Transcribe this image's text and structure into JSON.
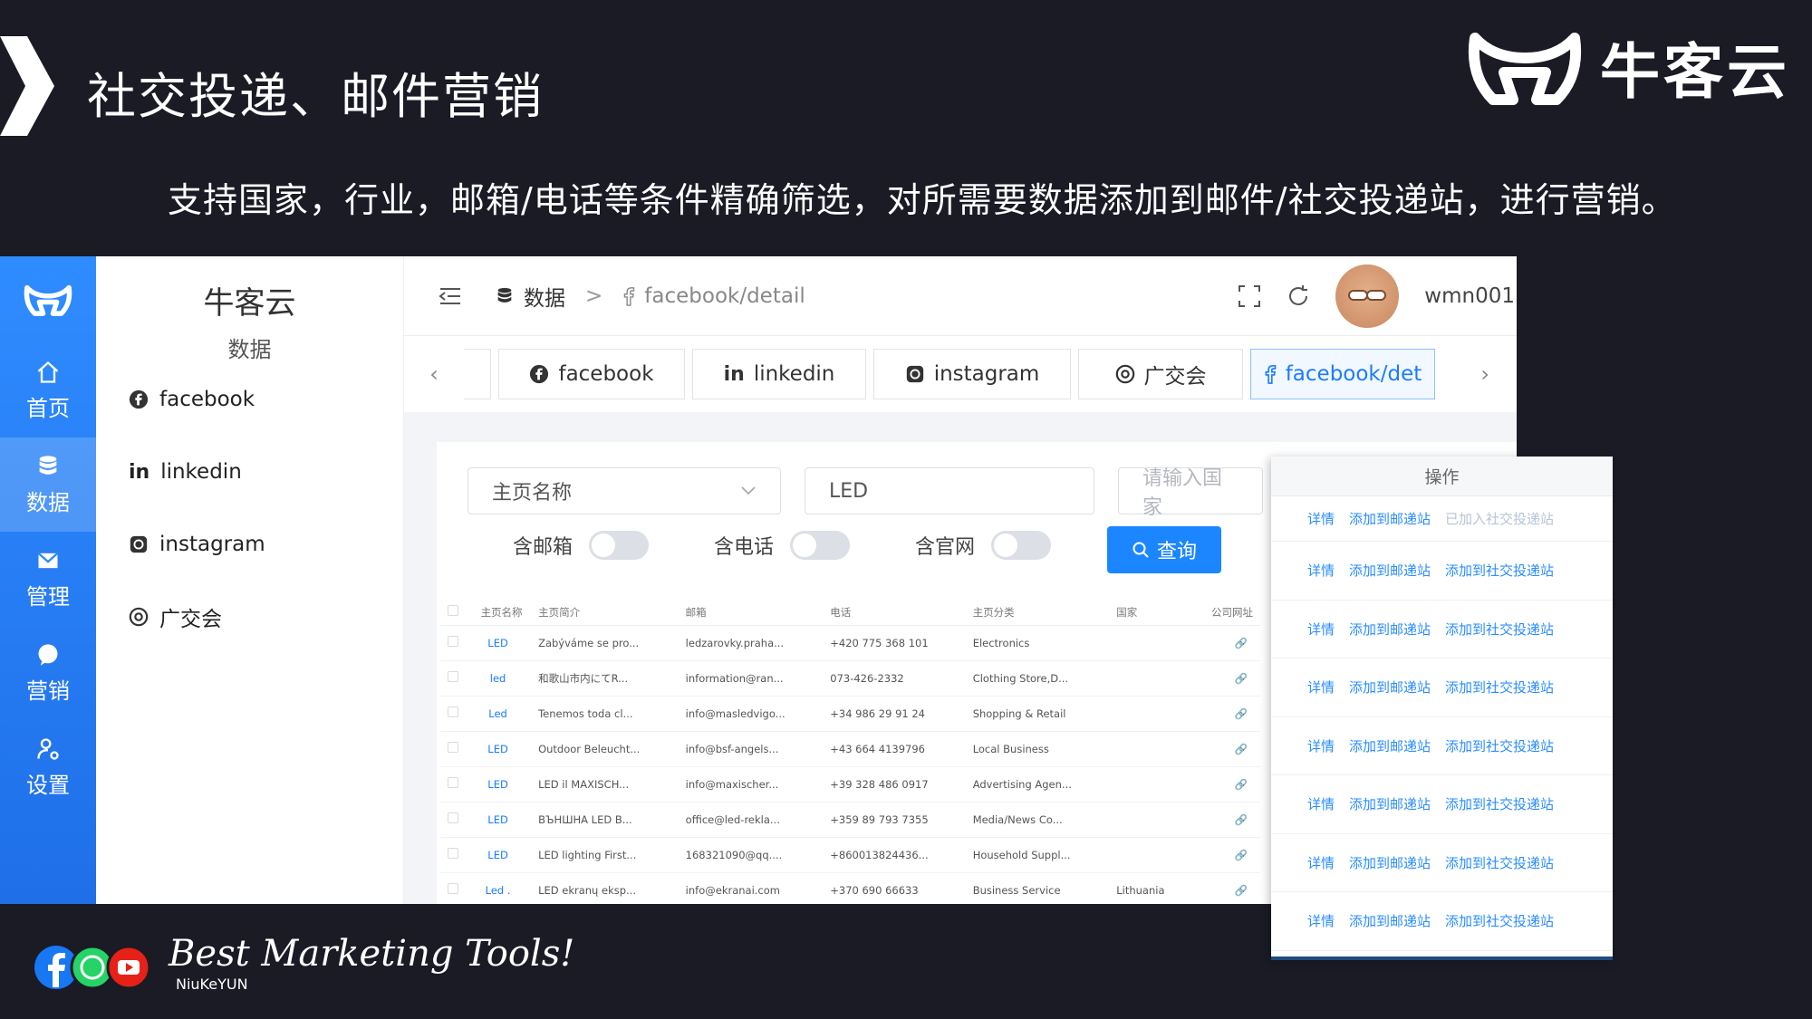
{
  "slide": {
    "title": "社交投递、邮件营销",
    "subtitle": "支持国家，行业，邮箱/电话等条件精确筛选，对所需要数据添加到邮件/社交投递站，进行营销。",
    "brand": "牛客云",
    "tagline": "Best Marketing Tools!",
    "tagline_sub": "NiuKeYUN"
  },
  "rail": [
    {
      "label": "首页",
      "icon": "home-icon"
    },
    {
      "label": "数据",
      "icon": "database-icon"
    },
    {
      "label": "管理",
      "icon": "mail-icon"
    },
    {
      "label": "营销",
      "icon": "chat-icon"
    },
    {
      "label": "设置",
      "icon": "user-settings-icon"
    }
  ],
  "side": {
    "title": "牛客云",
    "sub": "数据",
    "items": [
      "facebook",
      "linkedin",
      "instagram",
      "广交会"
    ]
  },
  "breadcrumb": {
    "first": "数据",
    "sep": ">",
    "second": "facebook/detail"
  },
  "user": {
    "name": "wmn001"
  },
  "tabs": [
    {
      "label": "facebook",
      "icon": "facebook-icon"
    },
    {
      "label": "linkedin",
      "icon": "linkedin-icon"
    },
    {
      "label": "instagram",
      "icon": "instagram-icon"
    },
    {
      "label": "广交会",
      "icon": "canton-fair-icon"
    },
    {
      "label": "facebook/det",
      "icon": "facebook-f-icon"
    }
  ],
  "filters": {
    "select_value": "主页名称",
    "keyword": "LED",
    "country_placeholder": "请输入国家",
    "toggles": [
      "含邮箱",
      "含电话",
      "含官网"
    ],
    "query_label": "查询"
  },
  "table": {
    "headers": [
      "",
      "主页名称",
      "主页简介",
      "邮箱",
      "电话",
      "主页分类",
      "国家",
      "公司网址"
    ],
    "rows": [
      [
        "LED",
        "Zabýváme se pro...",
        "ledzarovky.praha...",
        "+420 775 368 101",
        "Electronics",
        "",
        "🔗"
      ],
      [
        "led",
        "和歌山市内にてR...",
        "information@ran...",
        "073-426-2332",
        "Clothing Store,D...",
        "",
        "🔗"
      ],
      [
        "Led",
        "Tenemos toda cl...",
        "info@masledvigo...",
        "+34 986 29 91 24",
        "Shopping & Retail",
        "",
        "🔗"
      ],
      [
        "LED",
        "Outdoor Beleucht...",
        "info@bsf-angels...",
        "+43 664 4139796",
        "Local Business",
        "",
        "🔗"
      ],
      [
        "LED",
        "LED il MAXISCH...",
        "info@maxischer...",
        "+39 328 486 0917",
        "Advertising Agen...",
        "",
        "🔗"
      ],
      [
        "LED",
        "ВЪНШНА LED B...",
        "office@led-rekla...",
        "+359 89 793 7355",
        "Media/News Co...",
        "",
        "🔗"
      ],
      [
        "LED",
        "LED lighting First...",
        "168321090@qq....",
        "+860013824436...",
        "Household Suppl...",
        "",
        "🔗"
      ],
      [
        "Led .",
        "LED ekranų eksp...",
        "info@ekranai.com",
        "+370 690 66633",
        "Business Service",
        "Lithuania",
        "🔗"
      ]
    ]
  },
  "ops": {
    "header": "操作",
    "detail": "详情",
    "add_mail": "添加到邮递站",
    "add_social": "添加到社交投递站",
    "added_social": "已加入社交投递站",
    "first_row_added": true,
    "row_count": 8
  },
  "colors": {
    "accent": "#1b86ff",
    "rail": "#2f8cff",
    "bg": "#1a1b25"
  }
}
